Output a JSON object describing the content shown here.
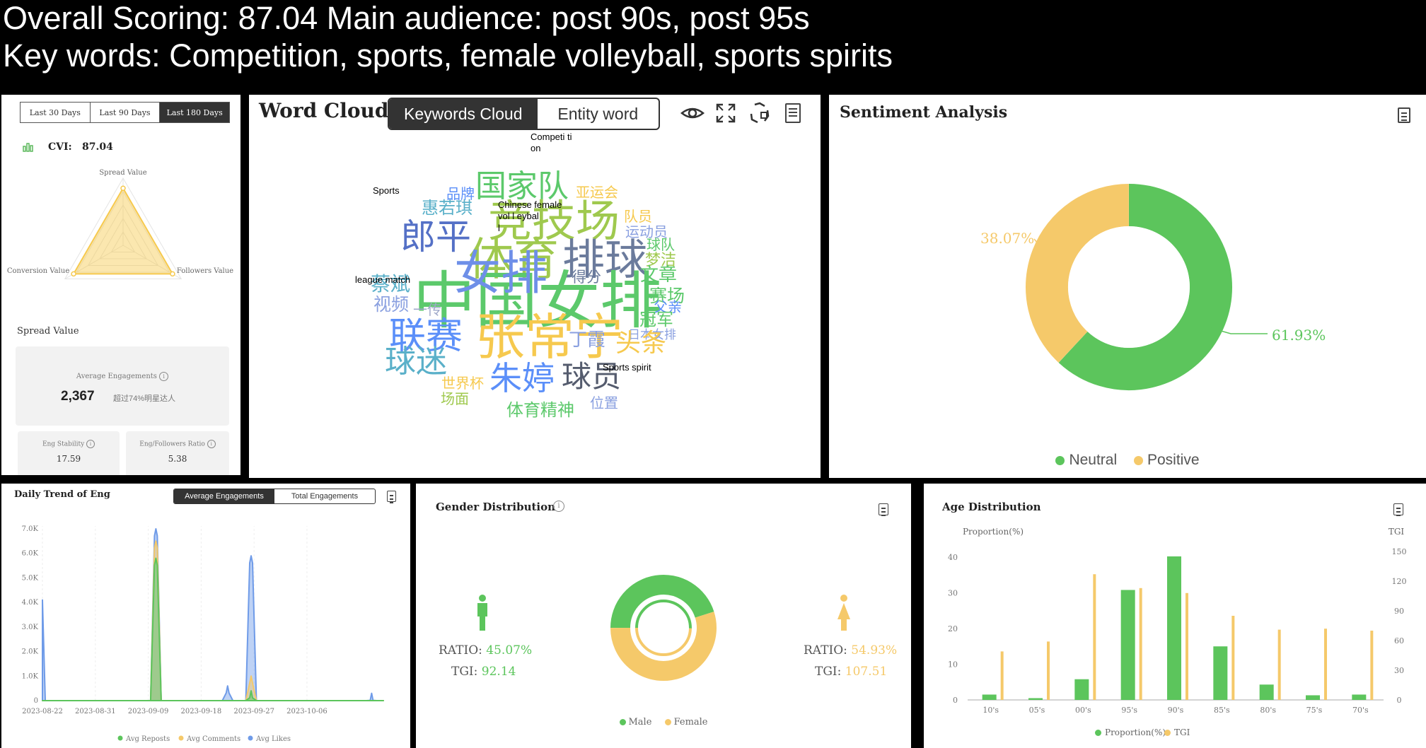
{
  "header": {
    "line1": "Overall Scoring: 87.04 Main audience: post 90s, post 95s",
    "line2": "Key words: Competition, sports, female volleyball, sports spirits"
  },
  "cvi_panel": {
    "tabs": [
      "Last 30 Days",
      "Last 90 Days",
      "Last 180 Days"
    ],
    "active_tab": "Last 180 Days",
    "cvi_label": "CVI:",
    "cvi_value": "87.04",
    "radar_labels": {
      "top": "Spread Value",
      "left": "Conversion Value",
      "right": "Followers Value"
    },
    "radar_levels": {
      "spread": 0.85,
      "conversion": 0.85,
      "followers": 0.85
    },
    "section_title": "Spread Value",
    "avg_engagements_label": "Average Engagements",
    "avg_engagements_value": "2,367",
    "avg_engagements_note": "超过74%明星达人",
    "eng_stability_label": "Eng Stability",
    "eng_stability_value": "17.59",
    "eng_followers_label": "Eng/Followers Ratio",
    "eng_followers_value": "5.38",
    "colors": {
      "accent": "#f6c94e",
      "cvi_icon": "#5cb85c"
    }
  },
  "word_cloud": {
    "title": "Word Cloud",
    "tabs": [
      "Keywords Cloud",
      "Entity word"
    ],
    "active_tab": "Keywords Cloud",
    "icons": [
      "eye-icon",
      "expand-icon",
      "refresh-icon",
      "document-icon"
    ],
    "words": [
      {
        "text": "品牌",
        "color": "#5b8ff9"
      },
      {
        "text": "国家队",
        "color": "#5cc96b"
      },
      {
        "text": "亚运会",
        "color": "#f6c94e"
      },
      {
        "text": "惠若琪",
        "color": "#5ab0c9"
      },
      {
        "text": "竞技场",
        "color": "#9fc94e"
      },
      {
        "text": "队员",
        "color": "#f6c94e"
      },
      {
        "text": "郎平",
        "color": "#5470c6"
      },
      {
        "text": "运动员",
        "color": "#8aa0e0"
      },
      {
        "text": "体育",
        "color": "#9fc94e"
      },
      {
        "text": "女排",
        "color": "#6e8fe8"
      },
      {
        "text": "排球",
        "color": "#6b7b9c"
      },
      {
        "text": "球队",
        "color": "#5cc96b"
      },
      {
        "text": "梦洁",
        "color": "#9fc94e"
      },
      {
        "text": "文章",
        "color": "#5cc96b"
      },
      {
        "text": "得分",
        "color": "#6b7b9c"
      },
      {
        "text": "蔡斌",
        "color": "#5ab0c9"
      },
      {
        "text": "中国女排",
        "color": "#5cc96b"
      },
      {
        "text": "赛场",
        "color": "#5cc96b"
      },
      {
        "text": "视频",
        "color": "#8aa0e0"
      },
      {
        "text": "父亲",
        "color": "#5b8ff9"
      },
      {
        "text": "一传",
        "color": "#9fa8c9"
      },
      {
        "text": "冠军",
        "color": "#5cc96b"
      },
      {
        "text": "日本女排",
        "color": "#8aa0e0"
      },
      {
        "text": "联赛",
        "color": "#5b8ff9"
      },
      {
        "text": "张常宁",
        "color": "#f6c94e"
      },
      {
        "text": "丁霞",
        "color": "#8aa0e0"
      },
      {
        "text": "头条",
        "color": "#f6c94e"
      },
      {
        "text": "球迷",
        "color": "#5ab0c9"
      },
      {
        "text": "朱婷",
        "color": "#5b8ff9"
      },
      {
        "text": "球员",
        "color": "#555c6e"
      },
      {
        "text": "世界杯",
        "color": "#f6c94e"
      },
      {
        "text": "场面",
        "color": "#9fc94e"
      },
      {
        "text": "体育精神",
        "color": "#5cc96b"
      },
      {
        "text": "位置",
        "color": "#8aa0e0"
      }
    ],
    "overlays": [
      "Competi ti\non",
      "Sports",
      "Chinese female\nvol l eybal\nl",
      "league match",
      "Sports spirit"
    ]
  },
  "sentiment": {
    "title": "Sentiment Analysis",
    "chart_data": {
      "type": "pie",
      "categories": [
        "Neutral",
        "Positive"
      ],
      "values": [
        61.93,
        38.07
      ],
      "labels": [
        "61.93%",
        "38.07%"
      ],
      "colors": [
        "#5cc55c",
        "#f5c96a"
      ],
      "legend": "bottom"
    }
  },
  "daily_trend": {
    "title": "Daily Trend of Eng",
    "tabs": [
      "Average Engagements",
      "Total Engagements"
    ],
    "active_tab": "Average Engagements",
    "chart_data": {
      "type": "area",
      "y_ticks": [
        "0",
        "1.0K",
        "2.0K",
        "3.0K",
        "4.0K",
        "5.0K",
        "6.0K",
        "7.0K"
      ],
      "ylim": [
        0,
        7500
      ],
      "x_ticks": [
        "2023-08-22",
        "2023-08-31",
        "2023-09-09",
        "2023-09-18",
        "2023-09-27",
        "2023-10-06"
      ],
      "series": [
        {
          "name": "Avg Likes",
          "color": "#6f9be8",
          "peaks": [
            {
              "day": 0,
              "value": 4100
            },
            {
              "day": 19.3,
              "value": 7000
            },
            {
              "day": 35.5,
              "value": 5900
            },
            {
              "day": 31.5,
              "value": 600
            },
            {
              "day": 56,
              "value": 300
            }
          ]
        },
        {
          "name": "Avg Comments",
          "color": "#f5c96a",
          "peaks": [
            {
              "day": 19.3,
              "value": 6500
            },
            {
              "day": 35.5,
              "value": 1000
            }
          ]
        },
        {
          "name": "Avg Reposts",
          "color": "#5cc55c",
          "peaks": [
            {
              "day": 19.3,
              "value": 5800
            },
            {
              "day": 35.5,
              "value": 400
            }
          ]
        }
      ],
      "legend": "bottom"
    }
  },
  "gender": {
    "title": "Gender Distribution",
    "male_ratio_label": "RATIO:",
    "male_ratio_value": "45.07%",
    "male_tgi_label": "TGI:",
    "male_tgi_value": "92.14",
    "female_ratio_label": "RATIO:",
    "female_ratio_value": "54.93%",
    "female_tgi_label": "TGI:",
    "female_tgi_value": "107.51",
    "legend": [
      "Male",
      "Female"
    ],
    "chart_data": {
      "type": "pie",
      "categories": [
        "Male",
        "Female"
      ],
      "values": [
        45.07,
        54.93
      ],
      "colors": [
        "#5cc55c",
        "#f5c96a"
      ],
      "legend": "bottom"
    }
  },
  "age": {
    "title": "Age Distribution",
    "left_axis_label": "Proportion(%)",
    "right_axis_label": "TGI",
    "chart_data": {
      "type": "bar",
      "categories": [
        "10's",
        "05's",
        "00's",
        "95's",
        "90's",
        "85's",
        "80's",
        "75's",
        "70's"
      ],
      "series": [
        {
          "name": "Proportion(%)",
          "color": "#5cc55c",
          "axis": "left",
          "values": [
            1.5,
            0.5,
            5.8,
            30.8,
            40.2,
            15.0,
            4.3,
            1.3,
            1.5
          ]
        },
        {
          "name": "TGI",
          "color": "#f5c96a",
          "axis": "right",
          "values": [
            49,
            59,
            127,
            113,
            108,
            85,
            71,
            72,
            70
          ]
        }
      ],
      "left_ticks": [
        "0",
        "10",
        "20",
        "30",
        "40"
      ],
      "right_ticks": [
        "0",
        "30",
        "60",
        "90",
        "120",
        "150"
      ],
      "ylim_left": [
        0,
        40
      ],
      "ylim_right": [
        0,
        150
      ],
      "legend": "bottom"
    }
  }
}
